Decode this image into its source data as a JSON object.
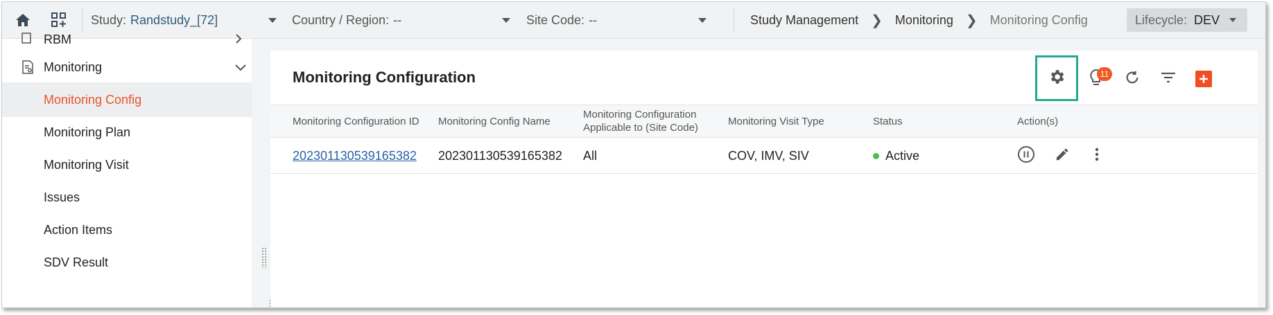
{
  "topbar": {
    "home_icon": "home-icon",
    "apps_icon": "add-grid-icon",
    "study_label": "Study:",
    "study_value": "Randstudy_[72]",
    "country_label": "Country / Region:",
    "country_value": "--",
    "site_label": "Site Code:",
    "site_value": "--",
    "breadcrumb": [
      "Study Management",
      "Monitoring",
      "Monitoring Config"
    ],
    "lifecycle_label": "Lifecycle:",
    "lifecycle_value": "DEV"
  },
  "sidebar": {
    "partial_top_label": "RBM",
    "section_label": "Monitoring",
    "items": [
      {
        "label": "Monitoring Config",
        "active": true
      },
      {
        "label": "Monitoring Plan"
      },
      {
        "label": "Monitoring Visit"
      },
      {
        "label": "Issues"
      },
      {
        "label": "Action Items"
      },
      {
        "label": "SDV Result"
      }
    ]
  },
  "main": {
    "title": "Monitoring Configuration",
    "toolbar": {
      "settings_icon": "gear-icon",
      "notifications_icon": "lightbulb-icon",
      "notifications_count": "11",
      "refresh_icon": "refresh-icon",
      "filter_icon": "filter-icon",
      "add_icon": "plus-icon"
    },
    "columns": [
      "Monitoring Configuration ID",
      "Monitoring Config Name",
      "Monitoring Configuration Applicable to (Site Code)",
      "Monitoring Visit Type",
      "Status",
      "Action(s)"
    ],
    "rows": [
      {
        "id": "202301130539165382",
        "name": "202301130539165382",
        "applicable": "All",
        "visit_type": "COV, IMV, SIV",
        "status": "Active",
        "status_color": "#4bbf4b"
      }
    ]
  },
  "colors": {
    "accent": "#e8552b",
    "highlight": "#23a88d",
    "link": "#2962a7"
  }
}
